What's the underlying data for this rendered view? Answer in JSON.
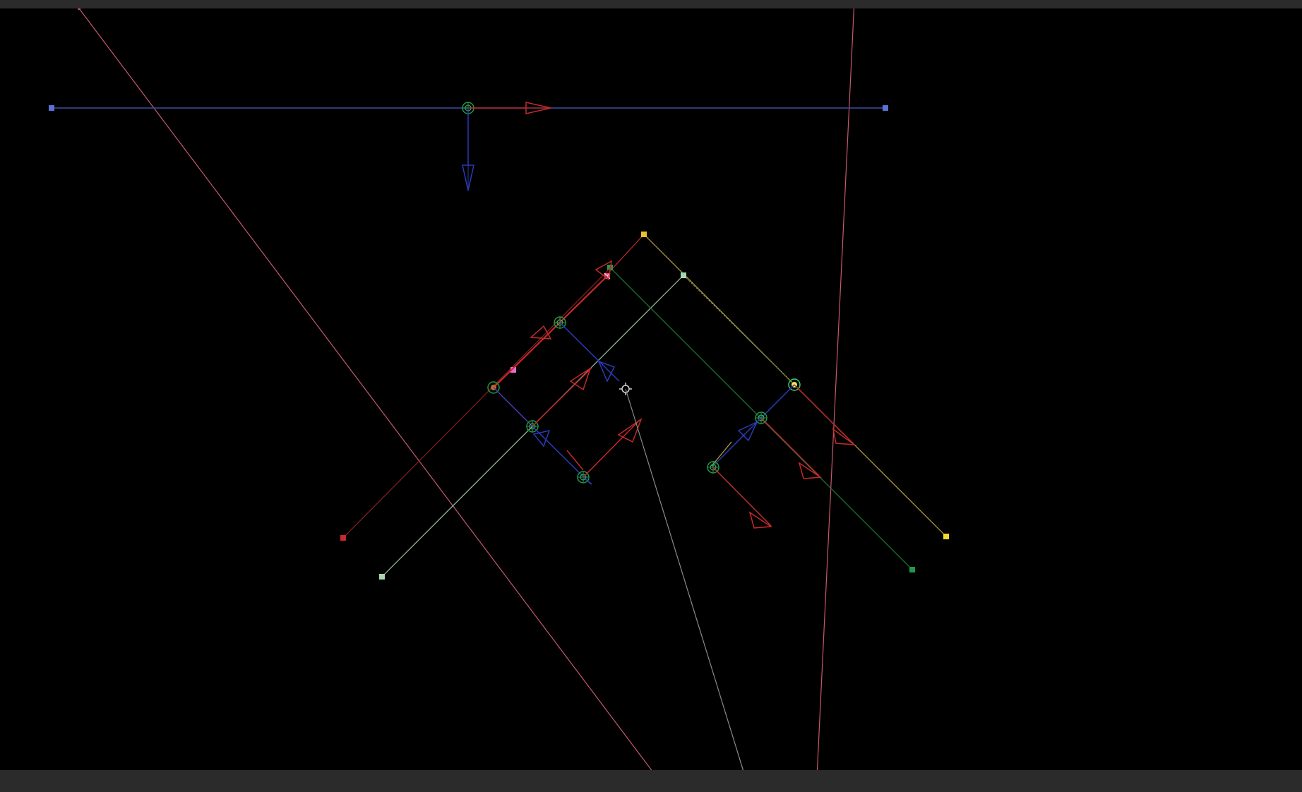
{
  "app": {
    "title": ""
  },
  "viewport": {
    "background": "#000000",
    "frame_color": "#2b2b2b"
  },
  "colors": {
    "blue": "#5d6fd6",
    "red": "#b62828",
    "green": "#1f9a48",
    "yellow": "#e8d84a",
    "pink": "#e66bd6",
    "light_green": "#a8d8b0",
    "camera_line": "#c8586e",
    "grey": "#9a9a9a"
  },
  "scene": {
    "icons": [
      "bone-joint-icon",
      "axis-arrow-icon",
      "control-point-icon",
      "camera-target-icon"
    ]
  }
}
